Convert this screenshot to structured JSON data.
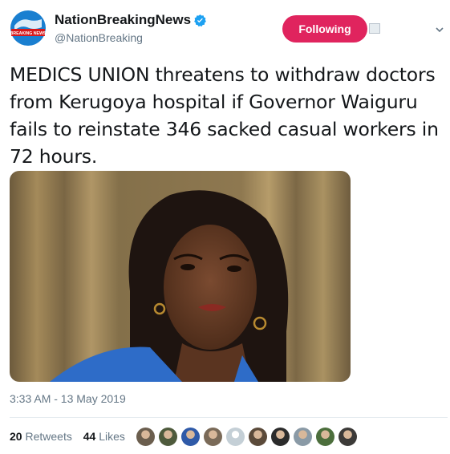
{
  "tweet": {
    "author": {
      "display_name": "NationBreakingNews",
      "handle": "@NationBreaking",
      "verified": true,
      "avatar_icon": "globe-logo-icon",
      "avatar_text": "BREAKING NEWS"
    },
    "follow_button_label": "Following",
    "text": "MEDICS UNION threatens to withdraw doctors from Kerugoya hospital if Governor Waiguru fails to reinstate 346 sacked casual workers in 72 hours.",
    "photo_icon": "photo-woman-portrait",
    "timestamp": "3:33 AM - 13 May 2019",
    "retweets": {
      "count": "20",
      "label": "Retweets"
    },
    "likes": {
      "count": "44",
      "label": "Likes"
    },
    "liker_avatars": [
      {
        "icon": "avatar-1",
        "color": "#6b5e4e"
      },
      {
        "icon": "avatar-2",
        "color": "#4e5a3c"
      },
      {
        "icon": "avatar-3",
        "color": "#2f5aa8"
      },
      {
        "icon": "avatar-4",
        "color": "#7a6a58"
      },
      {
        "icon": "avatar-default",
        "color": "#c4cfd6"
      },
      {
        "icon": "avatar-6",
        "color": "#5b4a3a"
      },
      {
        "icon": "avatar-7",
        "color": "#2b2b2b"
      },
      {
        "icon": "avatar-8",
        "color": "#8a9aa6"
      },
      {
        "icon": "avatar-9",
        "color": "#4c6e3c"
      },
      {
        "icon": "avatar-10",
        "color": "#3c3a38"
      }
    ]
  },
  "colors": {
    "follow_button_bg": "#e0245e",
    "secondary_text": "#657786",
    "verified_blue": "#1da1f2"
  }
}
